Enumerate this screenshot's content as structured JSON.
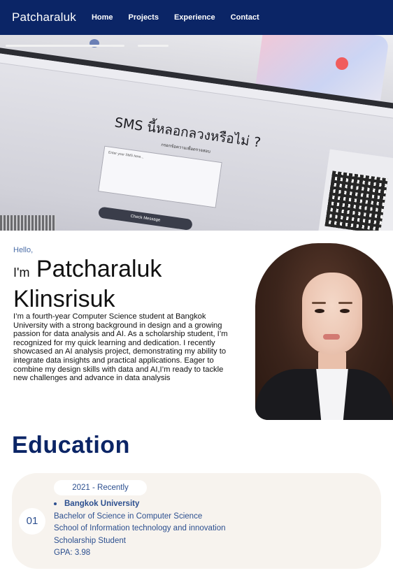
{
  "nav": {
    "brand": "Patcharaluk",
    "links": [
      "Home",
      "Projects",
      "Experience",
      "Contact"
    ]
  },
  "hero": {
    "sms_title": "SMS นี้หลอกลวงหรือไม่ ?",
    "sms_subtitle": "กรอกข้อความเพื่อตรวจสอบ",
    "sms_box_placeholder": "Enter your SMS here...",
    "sms_button": "Check Message"
  },
  "intro": {
    "hello": "Hello,",
    "im": "I'm",
    "first_name": "Patcharaluk",
    "last_name": "Klinsrisuk",
    "bio": "I’m a fourth-year Computer Science student at Bangkok University with a strong background in design and a growing passion for data analysis and AI. As a scholarship student, I’m recognized for my quick learning and dedication. I recently showcased an AI analysis project, demonstrating my ability to integrate data insights and practical applications. Eager to combine my design skills with data and AI,I’m ready to tackle new challenges and advance in data analysis"
  },
  "education": {
    "title": "Education",
    "items": [
      {
        "number": "01",
        "date": "2021 - Recently",
        "university": "Bangkok University",
        "degree": "Bachelor of Science in Computer Science",
        "school": "School of Information technology and innovation",
        "note": "Scholarship Student",
        "gpa": "GPA: 3.98"
      }
    ]
  },
  "colors": {
    "nav_bg": "#0b2566",
    "accent": "#2c4f8f",
    "card_bg": "#f7f3ee"
  }
}
